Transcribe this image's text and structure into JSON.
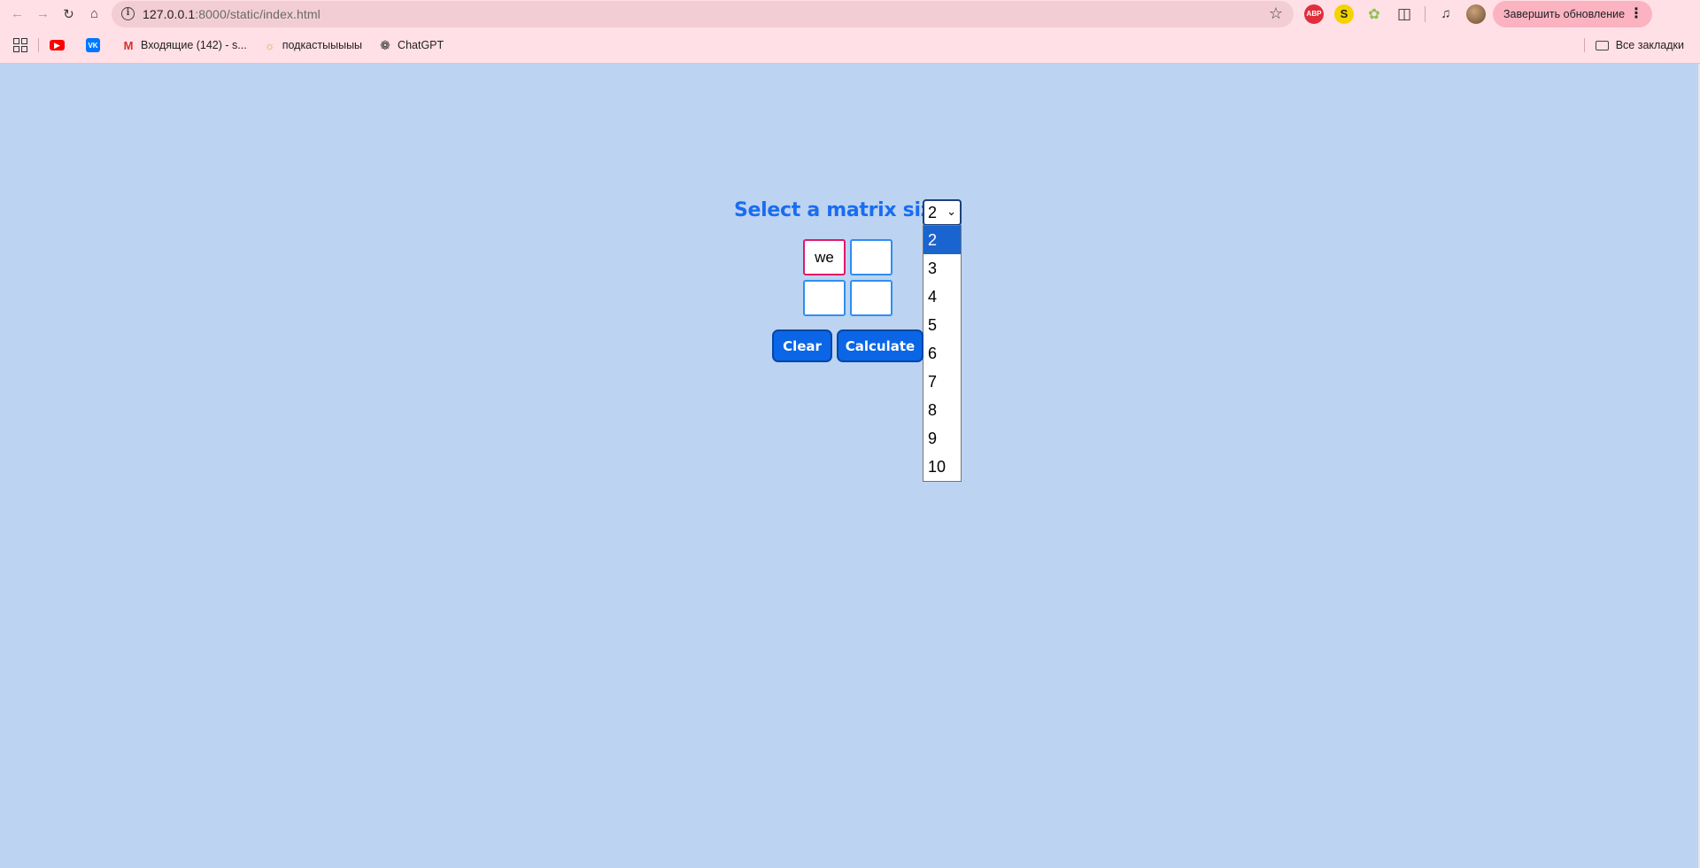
{
  "browser": {
    "url_host": "127.0.0.1",
    "url_path": ":8000/static/index.html",
    "update_button": "Завершить обновление",
    "extensions": [
      "ABP",
      "S"
    ],
    "bookmarks": [
      {
        "icon": "youtube-icon",
        "label": ""
      },
      {
        "icon": "vk-icon",
        "label": ""
      },
      {
        "icon": "gmail-icon",
        "label": "Входящие (142) - s..."
      },
      {
        "icon": "sun-icon",
        "label": "подкастыыыыы"
      },
      {
        "icon": "chatgpt-icon",
        "label": "ChatGPT"
      }
    ],
    "all_bookmarks": "Все закладки"
  },
  "page": {
    "title": "Select a matrix size",
    "selected_size": "2",
    "size_options": [
      "2",
      "3",
      "4",
      "5",
      "6",
      "7",
      "8",
      "9",
      "10"
    ],
    "matrix": [
      [
        "we",
        ""
      ],
      [
        "",
        ""
      ]
    ],
    "clear_label": "Clear",
    "calculate_label": "Calculate"
  },
  "colors": {
    "page_background": "#bcd4f1",
    "accent": "#1a6df0",
    "button": "#0a66e6",
    "active_cell_border": "#e0196a",
    "chrome_background": "#ffe0e6"
  }
}
